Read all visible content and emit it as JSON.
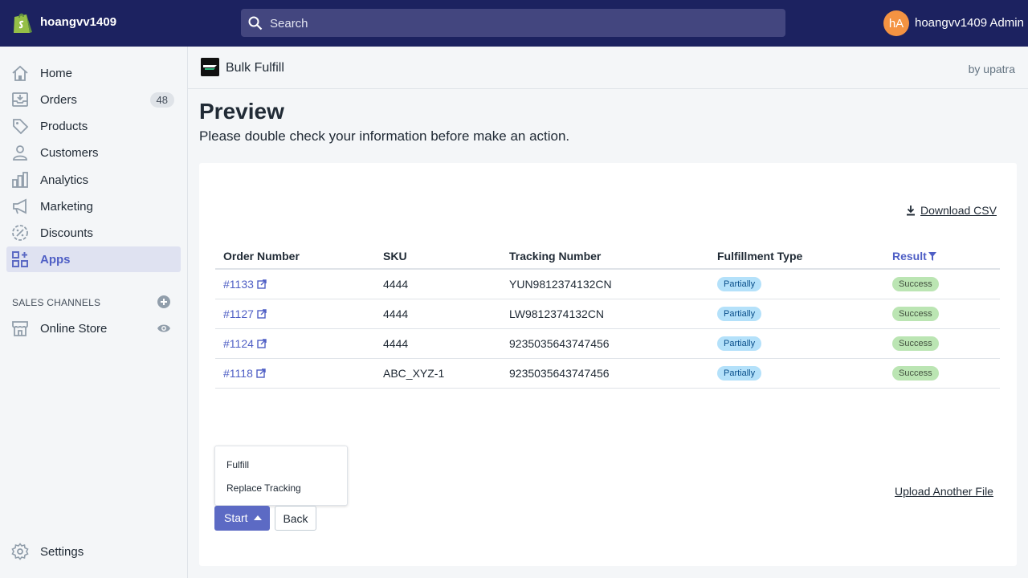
{
  "topbar": {
    "store_name": "hoangvv1409",
    "search_placeholder": "Search",
    "avatar_initials": "hA",
    "user_name": "hoangvv1409 Admin"
  },
  "sidebar": {
    "items": [
      {
        "label": "Home",
        "icon": "home-icon"
      },
      {
        "label": "Orders",
        "icon": "orders-icon",
        "badge": "48"
      },
      {
        "label": "Products",
        "icon": "tag-icon"
      },
      {
        "label": "Customers",
        "icon": "person-icon"
      },
      {
        "label": "Analytics",
        "icon": "bar-chart-icon"
      },
      {
        "label": "Marketing",
        "icon": "megaphone-icon"
      },
      {
        "label": "Discounts",
        "icon": "discount-icon"
      },
      {
        "label": "Apps",
        "icon": "apps-icon",
        "active": true
      }
    ],
    "sales_channels_title": "SALES CHANNELS",
    "online_store": "Online Store",
    "settings": "Settings"
  },
  "app": {
    "title": "Bulk Fulfill",
    "by": "by upatra"
  },
  "page": {
    "title": "Preview",
    "subtitle": "Please double check your information before make an action."
  },
  "card": {
    "download_label": "Download CSV",
    "columns": [
      "Order Number",
      "SKU",
      "Tracking Number",
      "Fulfillment Type",
      "Result"
    ],
    "rows": [
      {
        "order": "#1133",
        "sku": "4444",
        "tracking": "YUN9812374132CN",
        "type": "Partially",
        "result": "Success"
      },
      {
        "order": "#1127",
        "sku": "4444",
        "tracking": "LW9812374132CN",
        "type": "Partially",
        "result": "Success"
      },
      {
        "order": "#1124",
        "sku": "4444",
        "tracking": "9235035643747456",
        "type": "Partially",
        "result": "Success"
      },
      {
        "order": "#1118",
        "sku": "ABC_XYZ-1",
        "tracking": "9235035643747456",
        "type": "Partially",
        "result": "Success"
      }
    ],
    "dropdown_items": [
      "Fulfill",
      "Replace Tracking"
    ],
    "start_label": "Start",
    "back_label": "Back",
    "upload_label": "Upload Another File"
  },
  "colors": {
    "topbar": "#1c2260",
    "accent": "#5c6ac4",
    "link": "#4f5fc5",
    "partial_badge": "#b4e1fa",
    "success_badge": "#bbe5b3",
    "avatar": "#f49342"
  }
}
